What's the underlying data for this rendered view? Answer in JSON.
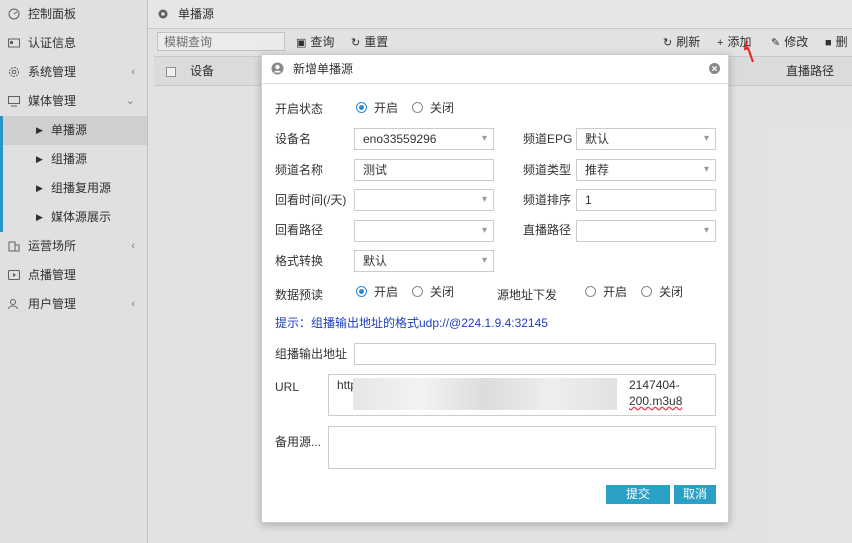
{
  "sidebar": {
    "items": [
      {
        "label": "控制面板",
        "icon": "dashboard-icon",
        "caret": ""
      },
      {
        "label": "认证信息",
        "icon": "id-card-icon",
        "caret": ""
      },
      {
        "label": "系统管理",
        "icon": "gear-icon",
        "caret": "‹"
      },
      {
        "label": "媒体管理",
        "icon": "monitor-icon",
        "caret": "⌄"
      }
    ],
    "media_sub": [
      "单播源",
      "组播源",
      "组播复用源",
      "媒体源展示"
    ],
    "bottom_items": [
      {
        "label": "运营场所",
        "icon": "building-icon",
        "caret": "‹"
      },
      {
        "label": "点播管理",
        "icon": "play-icon",
        "caret": ""
      },
      {
        "label": "用户管理",
        "icon": "users-icon",
        "caret": "‹"
      }
    ]
  },
  "main": {
    "title": "单播源",
    "search_placeholder": "模糊查询",
    "query_label": "查询",
    "reset_label": "重置",
    "refresh_label": "刷新",
    "add_label": "添加",
    "edit_label": "修改",
    "delete_label": "删",
    "table_headers": [
      "设备",
      "直播路径"
    ]
  },
  "dialog": {
    "title": "新增单播源",
    "enable_label": "开启状态",
    "enable_on": "开启",
    "enable_off": "关闭",
    "device_label": "设备名",
    "device_value": "eno33559296",
    "epg_label": "频道EPG",
    "epg_value": "默认",
    "channel_name_label": "频道名称",
    "channel_name_value": "测试",
    "channel_type_label": "频道类型",
    "channel_type_value": "推荐",
    "lookback_label": "回看时间(/天)",
    "lookback_value": "",
    "order_label": "频道排序",
    "order_value": "1",
    "lookback_path_label": "回看路径",
    "lookback_path_value": "",
    "live_path_label": "直播路径",
    "live_path_value": "",
    "format_label": "格式转换",
    "format_value": "默认",
    "preview_label": "数据预读",
    "preview_on": "开启",
    "preview_off": "关闭",
    "src_dispatch_label": "源地址下发",
    "src_on": "开启",
    "src_off": "关闭",
    "hint": "提示：组播输出地址的格式udp://@224.1.9.4:32145",
    "mc_out_label": "组播输出地址",
    "mc_out_value": "",
    "url_label": "URL",
    "url_line1_a": "http",
    "url_line1_b": "2147404-",
    "url_line2_b": "200.m3u8",
    "backup_label": "备用源...",
    "backup_value": "",
    "submit_label": "提交",
    "cancel_label": "取消"
  },
  "colors": {
    "accent": "#2aa0c6",
    "hint": "#1d3fbf",
    "arrow": "#e8232a"
  }
}
